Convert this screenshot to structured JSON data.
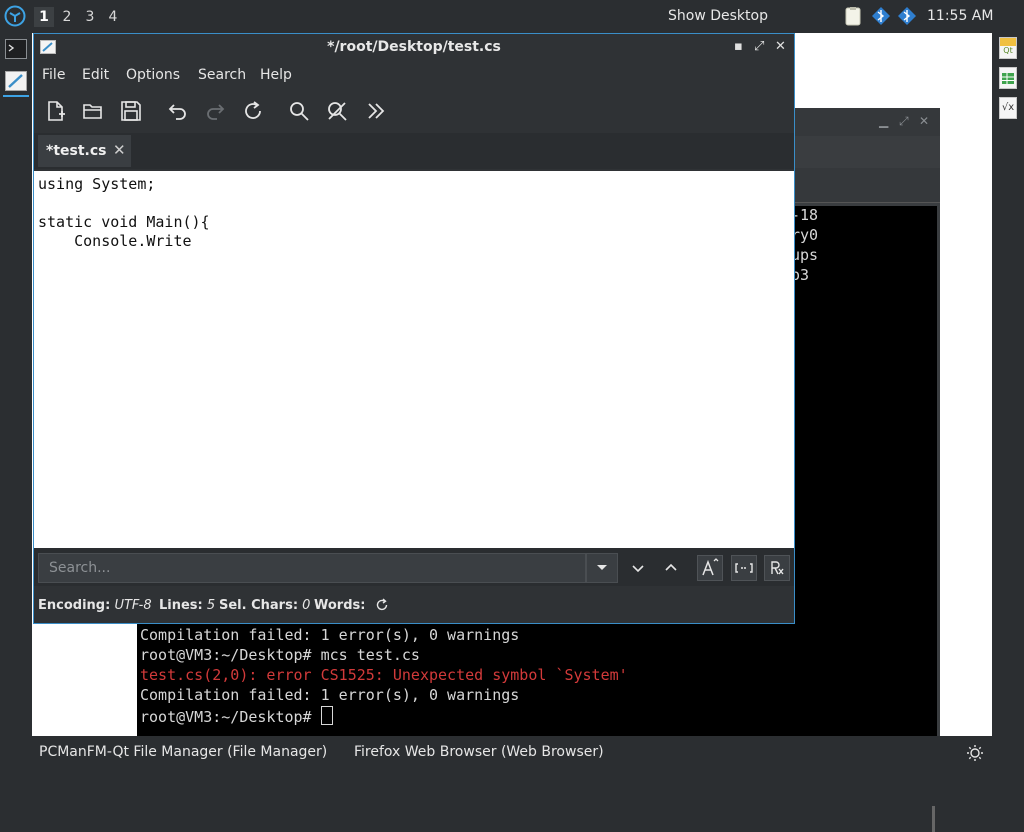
{
  "top_panel": {
    "workspaces": [
      "1",
      "2",
      "3",
      "4"
    ],
    "active_workspace": "1",
    "show_desktop_label": "Show Desktop",
    "clock": "11:55 AM",
    "app_menu_icon": "lxqt-logo-icon",
    "tray_icons": [
      "clipboard-icon",
      "network-icon",
      "bluetooth-icon"
    ]
  },
  "left_dock": {
    "items": [
      {
        "icon": "terminal-icon"
      },
      {
        "icon": "text-editor-icon"
      }
    ]
  },
  "right_dock": {
    "items": [
      {
        "icon": "qt-designer-icon",
        "badge": "Qt"
      },
      {
        "icon": "spreadsheet-icon"
      },
      {
        "icon": "formula-icon",
        "badge": "√x"
      }
    ]
  },
  "editor": {
    "title": "*/root/Desktop/test.cs",
    "menu": [
      "File",
      "Edit",
      "Options",
      "Search",
      "Help"
    ],
    "toolbar": [
      "new-file-icon",
      "open-folder-icon",
      "save-icon",
      "undo-icon",
      "redo-icon",
      "reload-icon",
      "find-icon",
      "find-replace-icon",
      "more-icon"
    ],
    "tab": {
      "label": "*test.cs",
      "close": "✕"
    },
    "code_lines": [
      "using System;",
      "",
      "static void Main(){",
      "    Console.Write"
    ],
    "search": {
      "placeholder": "Search..."
    },
    "status": {
      "encoding_label": "Encoding:",
      "encoding_value": "UTF-8",
      "lines_label": "Lines:",
      "lines_value": "5",
      "sel_label": "Sel. Chars:",
      "sel_value": "0",
      "words_label": "Words:"
    }
  },
  "terminal": {
    "fragments": [
      "-18",
      "ry0",
      "ups",
      "o3"
    ],
    "lines": [
      {
        "text": "Compilation failed: 1 error(s), 0 warnings",
        "type": "normal"
      },
      {
        "text": "root@VM3:~/Desktop# mcs test.cs",
        "type": "normal"
      },
      {
        "text": "test.cs(2,0): error CS1525: Unexpected symbol `System'",
        "type": "error"
      },
      {
        "text": "Compilation failed: 1 error(s), 0 warnings",
        "type": "normal"
      },
      {
        "text": "root@VM3:~/Desktop# ",
        "type": "prompt"
      }
    ]
  },
  "taskbar": {
    "tasks": [
      "PCManFM-Qt File Manager (File Manager)",
      "Firefox Web Browser (Web Browser)"
    ]
  },
  "colors": {
    "panel": "#2b2e31",
    "accent": "#3a8ec8",
    "error": "#d23a3a"
  }
}
